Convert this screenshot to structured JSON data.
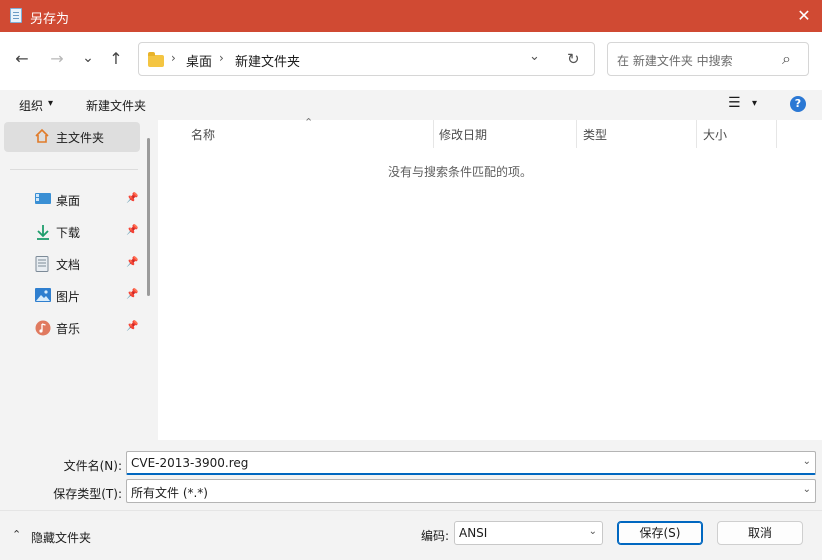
{
  "window": {
    "title": "另存为",
    "close": "✕"
  },
  "nav": {
    "back": "←",
    "forward": "→",
    "recent": "⌄",
    "up": "↑",
    "breadcrumb": [
      "桌面",
      "新建文件夹"
    ],
    "sep": "›",
    "address_dropdown": "⌄",
    "refresh": "↻",
    "search_placeholder": "在 新建文件夹 中搜索",
    "search_icon": "⌕"
  },
  "toolbar": {
    "organize": "组织",
    "organize_caret": "▾",
    "new_folder": "新建文件夹",
    "view_icon": "☰",
    "view_caret": "▾",
    "help": "?"
  },
  "sidebar": {
    "home": "主文件夹",
    "items": [
      {
        "label": "桌面",
        "icon": "desktop-icon"
      },
      {
        "label": "下载",
        "icon": "download-icon"
      },
      {
        "label": "文档",
        "icon": "document-icon"
      },
      {
        "label": "图片",
        "icon": "picture-icon"
      },
      {
        "label": "音乐",
        "icon": "music-icon"
      }
    ],
    "pin": "📌"
  },
  "content": {
    "columns": [
      "名称",
      "修改日期",
      "类型",
      "大小"
    ],
    "sort_indicator": "⌃",
    "empty_message": "没有与搜索条件匹配的项。"
  },
  "form": {
    "filename_label": "文件名(N):",
    "filename_value": "CVE-2013-3900.reg",
    "filetype_label": "保存类型(T):",
    "filetype_value": "所有文件  (*.*)",
    "dropdown": "⌄"
  },
  "footer": {
    "hide_folders": "隐藏文件夹",
    "hide_caret": "⌃",
    "encoding_label": "编码:",
    "encoding_value": "ANSI",
    "save": "保存(S)",
    "cancel": "取消"
  },
  "colors": {
    "titlebar": "#d04a33",
    "accent": "#0067c0"
  }
}
